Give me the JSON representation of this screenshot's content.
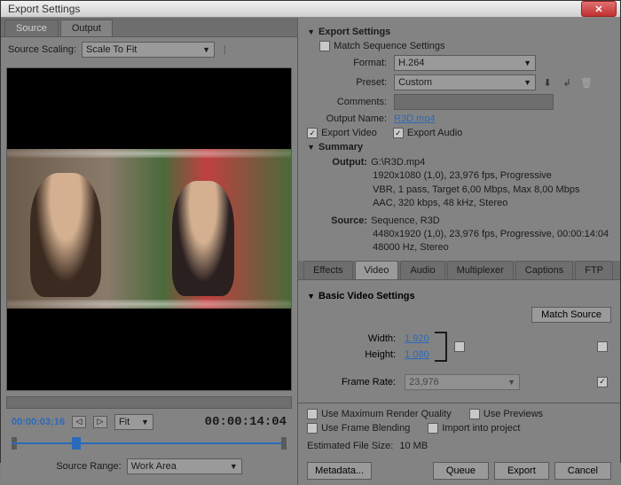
{
  "window": {
    "title": "Export Settings"
  },
  "left": {
    "tabs": {
      "source": "Source",
      "output": "Output",
      "active": "output"
    },
    "scaling": {
      "label": "Source Scaling:",
      "value": "Scale To Fit"
    },
    "tc_current": "00:00:03;16",
    "tc_total": "00:00:14:04",
    "fit_label": "Fit",
    "source_range": {
      "label": "Source Range:",
      "value": "Work Area"
    }
  },
  "export": {
    "title": "Export Settings",
    "match_seq": {
      "label": "Match Sequence Settings",
      "checked": false
    },
    "format": {
      "label": "Format:",
      "value": "H.264"
    },
    "preset": {
      "label": "Preset:",
      "value": "Custom"
    },
    "comments": {
      "label": "Comments:",
      "value": ""
    },
    "output_name": {
      "label": "Output Name:",
      "value": "R3D.mp4"
    },
    "export_video": {
      "label": "Export Video",
      "checked": true
    },
    "export_audio": {
      "label": "Export Audio",
      "checked": true
    }
  },
  "summary": {
    "title": "Summary",
    "output_label": "Output:",
    "output_path": "G:\\R3D.mp4",
    "output_line2": "1920x1080 (1,0), 23,976 fps, Progressive",
    "output_line3": "VBR, 1 pass, Target 6,00 Mbps, Max 8,00 Mbps",
    "output_line4": "AAC, 320 kbps, 48 kHz, Stereo",
    "source_label": "Source:",
    "source_line1": "Sequence, R3D",
    "source_line2": "4480x1920 (1,0), 23,976 fps, Progressive, 00:00:14:04",
    "source_line3": "48000 Hz, Stereo"
  },
  "subtabs": {
    "effects": "Effects",
    "video": "Video",
    "audio": "Audio",
    "multiplexer": "Multiplexer",
    "captions": "Captions",
    "ftp": "FTP",
    "active": "video"
  },
  "basic_video": {
    "title": "Basic Video Settings",
    "match_source": "Match Source",
    "width_label": "Width:",
    "width_value": "1 920",
    "height_label": "Height:",
    "height_value": "1 080",
    "framerate_label": "Frame Rate:",
    "framerate_value": "23,976"
  },
  "bottom": {
    "max_render": "Use Maximum Render Quality",
    "previews": "Use Previews",
    "frame_blend": "Use Frame Blending",
    "import_proj": "Import into project",
    "est_label": "Estimated File Size:",
    "est_value": "10 MB"
  },
  "buttons": {
    "metadata": "Metadata...",
    "queue": "Queue",
    "export": "Export",
    "cancel": "Cancel"
  }
}
